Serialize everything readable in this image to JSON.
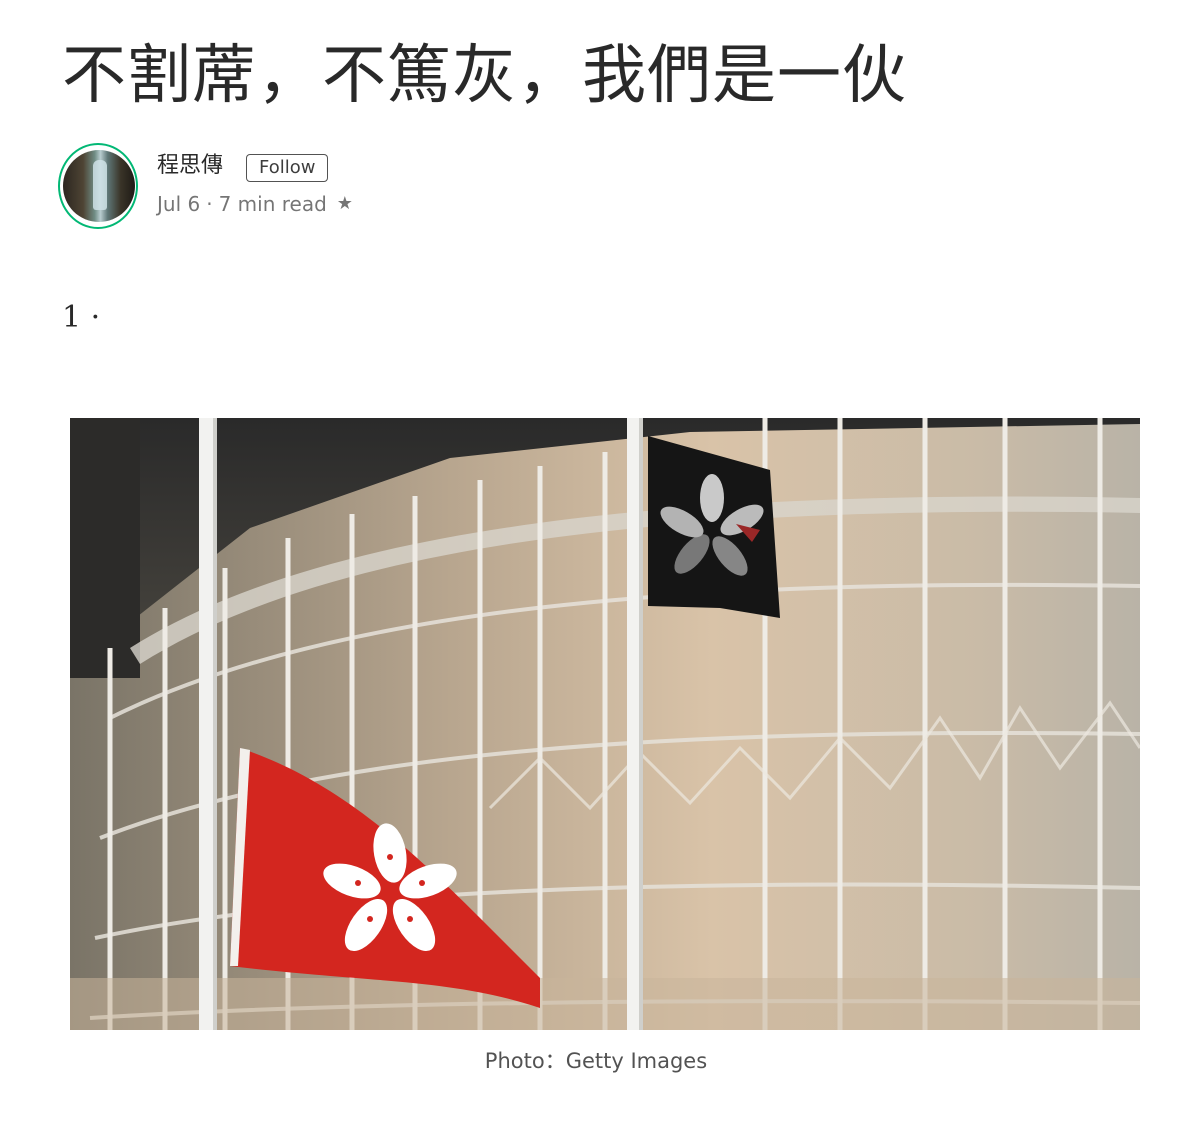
{
  "article": {
    "title": "不割蓆，不篤灰，我們是一伙",
    "section_marker": "1 ·"
  },
  "author": {
    "name": "程思傳",
    "follow_label": "Follow",
    "date": "Jul 6",
    "separator": "·",
    "read_time": "7 min read",
    "star_icon": "star-icon"
  },
  "figure": {
    "caption": "Photo：Getty Images"
  },
  "colors": {
    "accent_ring": "#02b875",
    "hk_flag_red": "#d3261f",
    "black_flag": "#151515"
  }
}
